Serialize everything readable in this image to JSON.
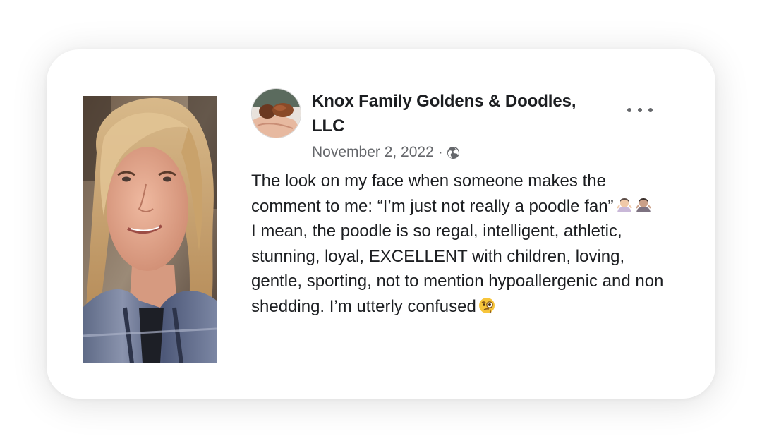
{
  "post": {
    "page_name": "Knox Family Goldens & Doodles, LLC",
    "date": "November 2, 2022",
    "separator": "·",
    "visibility_icon": "globe-icon",
    "more_icon": "more-options-icon",
    "avatar_icon": "puppy-avatar",
    "text_line_1": "The look on my face when someone makes the comment to me: “I’m just not really a poodle fan”",
    "text_line_1_emojis": [
      "woman-shrugging-emoji",
      "woman-shrugging-emoji"
    ],
    "text_line_2": "I mean, the poodle is so regal, intelligent, athletic, stunning, loyal, EXCELLENT with children, loving, gentle, sporting, not to mention hypoallergenic and non shedding. I’m utterly confused",
    "text_line_2_emoji": "face-with-monocle-emoji"
  },
  "photo": {
    "subject": "woman-portrait-photo"
  },
  "colors": {
    "text_primary": "#1c1e21",
    "text_secondary": "#65676b",
    "card_background": "#ffffff"
  }
}
